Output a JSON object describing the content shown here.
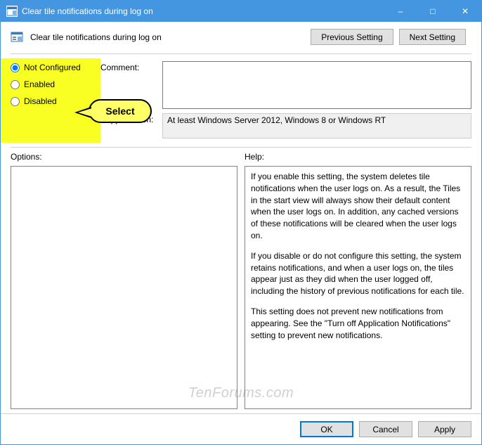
{
  "window": {
    "title": "Clear tile notifications during log on"
  },
  "header": {
    "policy_name": "Clear tile notifications during log on",
    "prev_btn": "Previous Setting",
    "next_btn": "Next Setting"
  },
  "state": {
    "options": {
      "not_configured": "Not Configured",
      "enabled": "Enabled",
      "disabled": "Disabled"
    },
    "selected": "not_configured"
  },
  "labels": {
    "comment": "Comment:",
    "supported": "Supported on:",
    "options": "Options:",
    "help": "Help:"
  },
  "fields": {
    "comment": "",
    "supported": "At least Windows Server 2012, Windows 8 or Windows RT"
  },
  "help": {
    "p1": "If you enable this setting, the system deletes tile notifications when the user logs on. As a result, the Tiles in the start view will always show their default content when the user logs on. In addition, any cached versions of these notifications will be cleared when the user logs on.",
    "p2": "If you disable or do not configure this setting, the system retains notifications, and when a user logs on, the tiles appear just as they did when the user logged off, including the history of previous notifications for each tile.",
    "p3": "This setting does not prevent new notifications from appearing. See the \"Turn off Application Notifications\" setting to prevent new notifications."
  },
  "footer": {
    "ok": "OK",
    "cancel": "Cancel",
    "apply": "Apply"
  },
  "annotation": {
    "callout": "Select"
  },
  "watermark": "TenForums.com"
}
